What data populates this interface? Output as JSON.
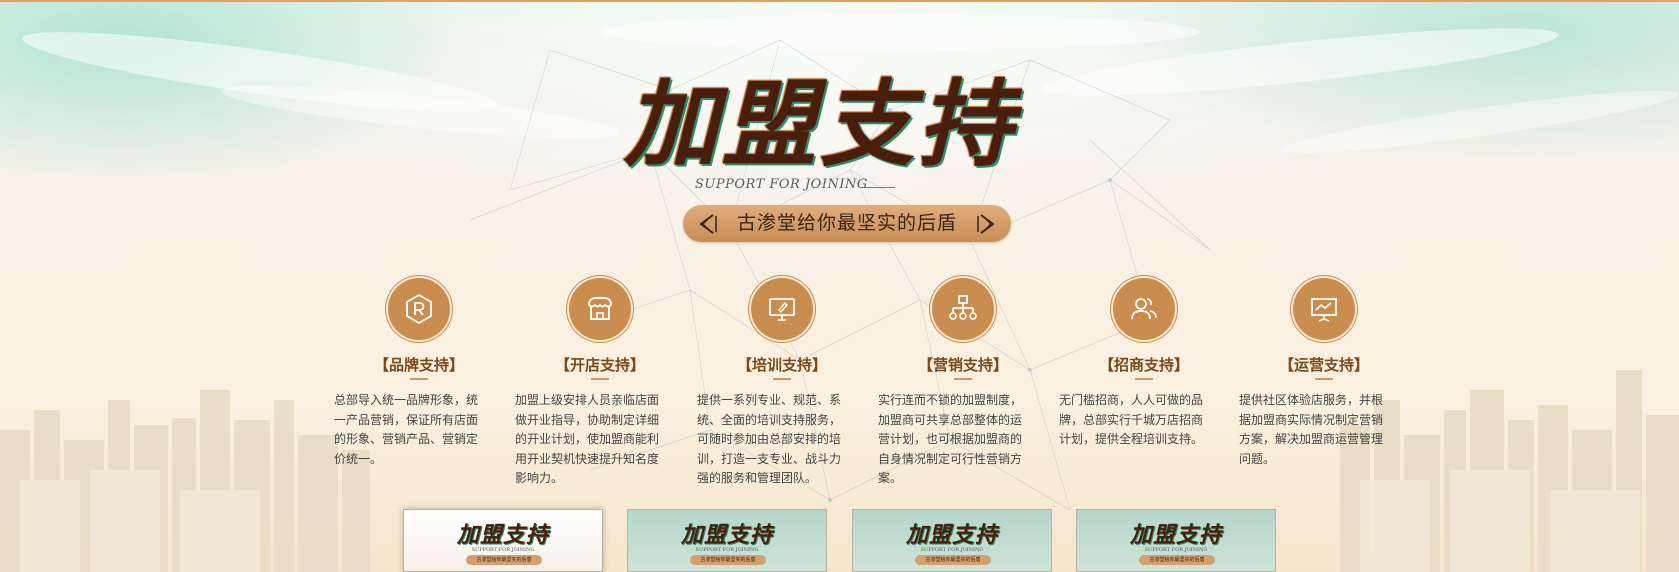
{
  "header": {
    "title": "加盟支持",
    "subtitle_en": "SUPPORT FOR JOINING",
    "slogan": "古渗堂给你最坚实的后盾"
  },
  "features": [
    {
      "title": "【品牌支持】",
      "icon": "registered-trademark-icon",
      "desc": "总部导入统一品牌形象，统一产品营销，保证所有店面的形象、营销产品、营销定价统一。"
    },
    {
      "title": "【开店支持】",
      "icon": "storefront-icon",
      "desc": "加盟上级安排人员亲临店面做开业指导，协助制定详细的开业计划，使加盟商能利用开业契机快速提升知名度影响力。"
    },
    {
      "title": "【培训支持】",
      "icon": "monitor-training-icon",
      "desc": "提供一系列专业、规范、系统、全面的培训支持服务，可随时参加由总部安排的培训，打造一支专业、战斗力强的服务和管理团队。"
    },
    {
      "title": "【营销支持】",
      "icon": "org-chart-icon",
      "desc": "实行连而不锁的加盟制度，加盟商可共享总部整体的运营计划，也可根据加盟商的自身情况制定可行性营销方案。"
    },
    {
      "title": "【招商支持】",
      "icon": "users-icon",
      "desc": "无门槛招商，人人可做的品牌，总部实行千城万店招商计划，提供全程培训支持。"
    },
    {
      "title": "【运营支持】",
      "icon": "presentation-board-icon",
      "desc": "提供社区体验店服务，并根据加盟商实际情况制定营销方案，解决加盟商运营管理问题。"
    }
  ],
  "thumbnails": [
    {
      "title": "加盟支持",
      "subtitle_en": "SUPPORT FOR JOINING",
      "slogan": "古渗堂给你最坚实的后盾",
      "state": "active"
    },
    {
      "title": "加盟支持",
      "subtitle_en": "SUPPORT FOR JOINING",
      "slogan": "古渗堂给你最坚实的后盾",
      "state": "inactive"
    },
    {
      "title": "加盟支持",
      "subtitle_en": "SUPPORT FOR JOINING",
      "slogan": "古渗堂给你最坚实的后盾",
      "state": "inactive"
    },
    {
      "title": "加盟支持",
      "subtitle_en": "SUPPORT FOR JOINING",
      "slogan": "古渗堂给你最坚实的后盾",
      "state": "inactive"
    }
  ],
  "colors": {
    "accent": "#c88d4f",
    "title_brown": "#4a1e0c",
    "feature_title": "#7a4a1c",
    "body_text": "#444444",
    "top_line": "#e0a357"
  }
}
